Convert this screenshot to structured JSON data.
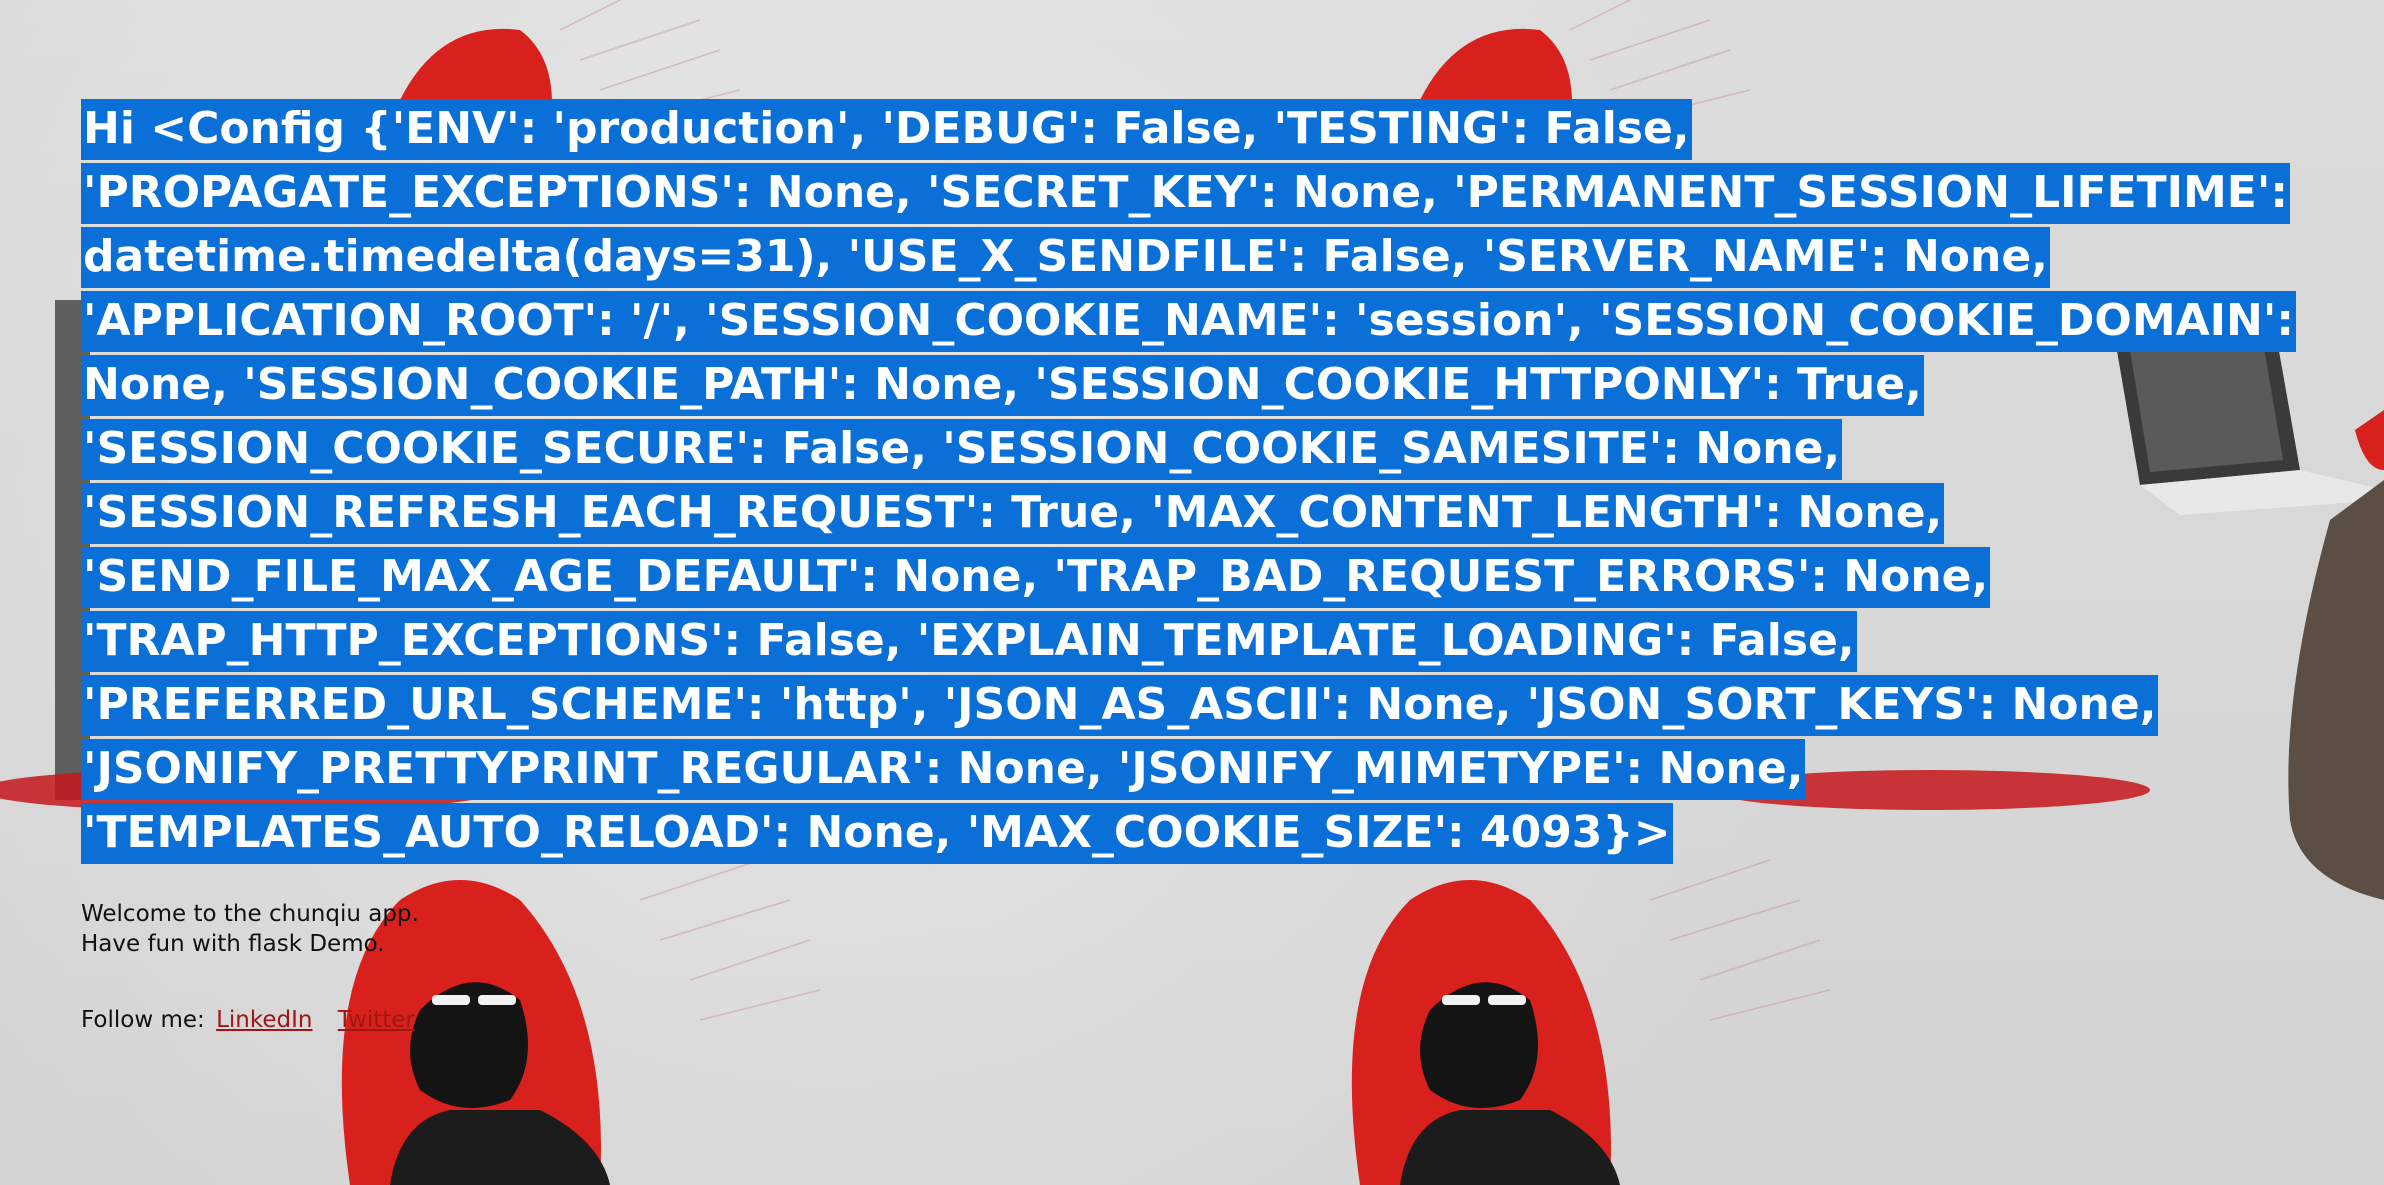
{
  "config_line": "Hi <Config {'ENV': 'production', 'DEBUG': False, 'TESTING': False, 'PROPAGATE_EXCEPTIONS': None, 'SECRET_KEY': None, 'PERMANENT_SESSION_LIFETIME': datetime.timedelta(days=31), 'USE_X_SENDFILE': False, 'SERVER_NAME': None, 'APPLICATION_ROOT': '/', 'SESSION_COOKIE_NAME': 'session', 'SESSION_COOKIE_DOMAIN': None, 'SESSION_COOKIE_PATH': None, 'SESSION_COOKIE_HTTPONLY': True, 'SESSION_COOKIE_SECURE': False, 'SESSION_COOKIE_SAMESITE': None, 'SESSION_REFRESH_EACH_REQUEST': True, 'MAX_CONTENT_LENGTH': None, 'SEND_FILE_MAX_AGE_DEFAULT': None, 'TRAP_BAD_REQUEST_ERRORS': None, 'TRAP_HTTP_EXCEPTIONS': False, 'EXPLAIN_TEMPLATE_LOADING': False, 'PREFERRED_URL_SCHEME': 'http', 'JSON_AS_ASCII': None, 'JSON_SORT_KEYS': None, 'JSONIFY_PRETTYPRINT_REGULAR': None, 'JSONIFY_MIMETYPE': None, 'TEMPLATES_AUTO_RELOAD': None, 'MAX_COOKIE_SIZE': 4093}>",
  "welcome_line_1": "Welcome to the chunqiu app.",
  "welcome_line_2": "Have fun with flask Demo.",
  "follow": {
    "prefix": "Follow me:",
    "links": [
      {
        "label": "LinkedIn"
      },
      {
        "label": "Twitter"
      }
    ]
  },
  "colors": {
    "selection_highlight": "#0a6fd6",
    "link": "#a01616",
    "background": "#d9d9d9",
    "figure_hood": "#d8201c"
  },
  "icons": [
    "hooded-figure-illustration"
  ]
}
